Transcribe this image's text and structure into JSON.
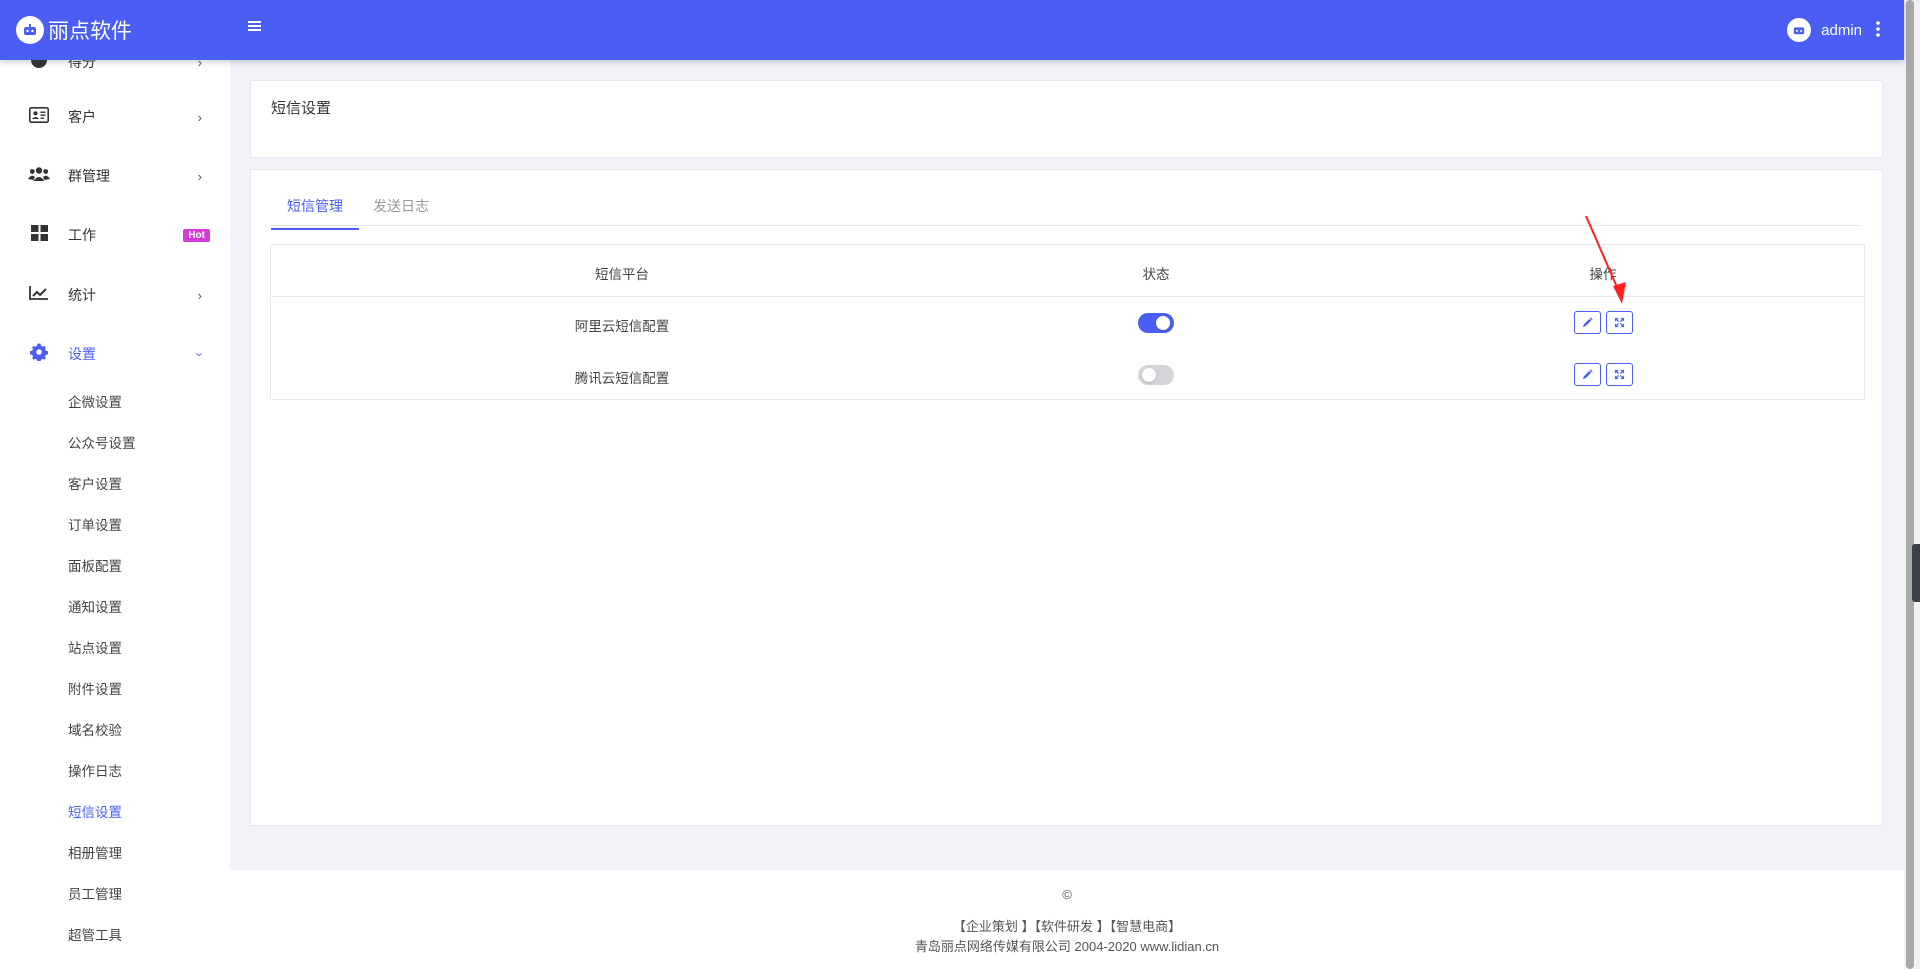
{
  "topbar": {
    "brand_name": "丽点软件",
    "user_name": "admin",
    "colors": {
      "primary": "#4a5ef3",
      "hot_badge": "#d63bd9"
    }
  },
  "sidebar": {
    "partial_item": "得分",
    "items": [
      {
        "key": "customer",
        "label": "客户",
        "icon": "id-card-icon"
      },
      {
        "key": "group",
        "label": "群管理",
        "icon": "users-icon"
      },
      {
        "key": "work",
        "label": "工作",
        "icon": "grid-icon",
        "badge": "Hot"
      },
      {
        "key": "stats",
        "label": "统计",
        "icon": "chart-line-icon"
      },
      {
        "key": "settings",
        "label": "设置",
        "icon": "gear-icon"
      }
    ],
    "sub_items": [
      "企微设置",
      "公众号设置",
      "客户设置",
      "订单设置",
      "面板配置",
      "通知设置",
      "站点设置",
      "附件设置",
      "域名校验",
      "操作日志",
      "短信设置",
      "相册管理",
      "员工管理",
      "超管工具"
    ],
    "active_sub": "短信设置"
  },
  "page": {
    "title": "短信设置",
    "tabs": [
      "短信管理",
      "发送日志"
    ],
    "active_tab": "短信管理"
  },
  "table": {
    "headers": [
      "短信平台",
      "状态",
      "操作"
    ],
    "rows": [
      {
        "platform": "阿里云短信配置",
        "enabled": true
      },
      {
        "platform": "腾讯云短信配置",
        "enabled": false
      }
    ]
  },
  "footer": {
    "copyright": "©",
    "links": "【企业策划 】【软件研发 】【智慧电商】",
    "company": "青岛丽点网络传媒有限公司 2004-2020 www.lidian.cn"
  }
}
